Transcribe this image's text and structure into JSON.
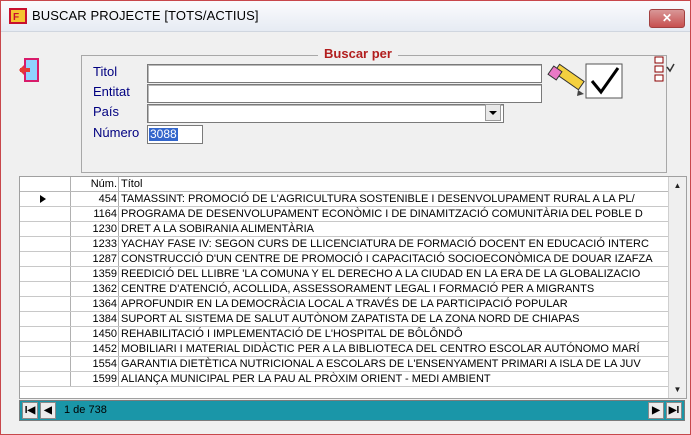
{
  "window": {
    "title": "BUSCAR PROJECTE [TOTS/ACTIUS]",
    "close_label": "✕"
  },
  "search": {
    "group_title": "Buscar per",
    "labels": {
      "titol": "Titol",
      "entitat": "Entitat",
      "pais": "País",
      "numero": "Número"
    },
    "values": {
      "titol": "",
      "entitat": "",
      "pais": "",
      "numero": "3088"
    }
  },
  "grid": {
    "columns": {
      "num": "Núm.",
      "titol": "Títol"
    },
    "rows": [
      {
        "num": "454",
        "titol": "TAMASSINT: PROMOCIÓ DE L'AGRICULTURA SOSTENIBLE I DESENVOLUPAMENT RURAL A LA PL/"
      },
      {
        "num": "1164",
        "titol": "PROGRAMA DE DESENVOLUPAMENT ECONÒMIC I DE DINAMITZACIÓ COMUNITÀRIA DEL POBLE D"
      },
      {
        "num": "1230",
        "titol": "DRET A LA SOBIRANIA ALIMENTÀRIA"
      },
      {
        "num": "1233",
        "titol": "YACHAY FASE IV: SEGON CURS DE LLICENCIATURA DE FORMACIÓ DOCENT EN EDUCACIÓ INTERC"
      },
      {
        "num": "1287",
        "titol": "CONSTRUCCIÓ D'UN CENTRE DE PROMOCIÓ I CAPACITACIÓ SOCIOECONÒMICA DE DOUAR IZAFZA"
      },
      {
        "num": "1359",
        "titol": "REEDICIÓ DEL LLIBRE 'LA COMUNA Y EL DERECHO A LA CIUDAD EN LA ERA DE LA GLOBALIZACIO"
      },
      {
        "num": "1362",
        "titol": "CENTRE D'ATENCIÓ, ACOLLIDA, ASSESSORAMENT LEGAL I FORMACIÓ PER A MIGRANTS"
      },
      {
        "num": "1364",
        "titol": "APROFUNDIR EN LA DEMOCRÀCIA LOCAL A TRAVÉS DE LA PARTICIPACIÓ POPULAR"
      },
      {
        "num": "1384",
        "titol": "SUPORT AL SISTEMA DE SALUT AUTÒNOM ZAPATISTA DE LA ZONA NORD DE CHIAPAS"
      },
      {
        "num": "1450",
        "titol": "REHABILITACIÓ I IMPLEMENTACIÓ DE L'HOSPITAL DE BÔLÔNDÔ"
      },
      {
        "num": "1452",
        "titol": "MOBILIARI I MATERIAL DIDÀCTIC PER A LA BIBLIOTECA DEL CENTRO ESCOLAR AUTÓNOMO MARÍ"
      },
      {
        "num": "1554",
        "titol": "GARANTIA DIETÈTICA NUTRICIONAL A ESCOLARS DE L'ENSENYAMENT PRIMARI A ISLA DE LA JUV"
      },
      {
        "num": "1599",
        "titol": "ALIANÇA MUNICIPAL PER LA PAU AL PRÒXIM ORIENT - MEDI AMBIENT"
      }
    ]
  },
  "navigator": {
    "status": "1 de 738",
    "first": "I◀",
    "prev": "◀",
    "next": "▶",
    "last": "▶I"
  },
  "colors": {
    "accent_red": "#b21e1e",
    "label_blue": "#000080",
    "nav_teal": "#1a96a8",
    "selection": "#3366cc"
  }
}
